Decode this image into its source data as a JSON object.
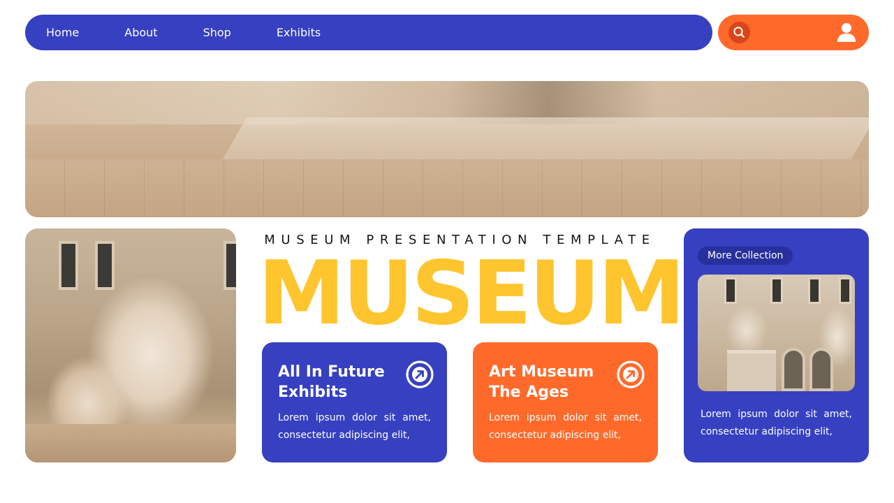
{
  "nav": {
    "items": [
      {
        "label": "Home"
      },
      {
        "label": "About"
      },
      {
        "label": "Shop"
      },
      {
        "label": "Exhibits"
      }
    ]
  },
  "utility": {
    "search_icon": "search-icon",
    "user_icon": "user-icon"
  },
  "hero": {
    "subtitle": "MUSEUM PRESENTATION TEMPLATE",
    "title": "MUSEUM"
  },
  "cards": [
    {
      "title": "All In Future Exhibits",
      "body": "Lorem ipsum dolor sit amet, consectetur adipiscing elit,",
      "icon": "arrow-up-right-circle-icon"
    },
    {
      "title": "Art Museum The Ages",
      "body": "Lorem ipsum dolor sit amet, consectetur adipiscing elit,",
      "icon": "arrow-up-right-circle-icon"
    }
  ],
  "side_panel": {
    "pill_label": "More Collection",
    "body": "Lorem ipsum dolor sit amet, consectetur adipiscing elit,"
  },
  "colors": {
    "blue": "#3640c0",
    "orange": "#ff6a2b",
    "yellow": "#ffc52e",
    "white": "#ffffff"
  }
}
